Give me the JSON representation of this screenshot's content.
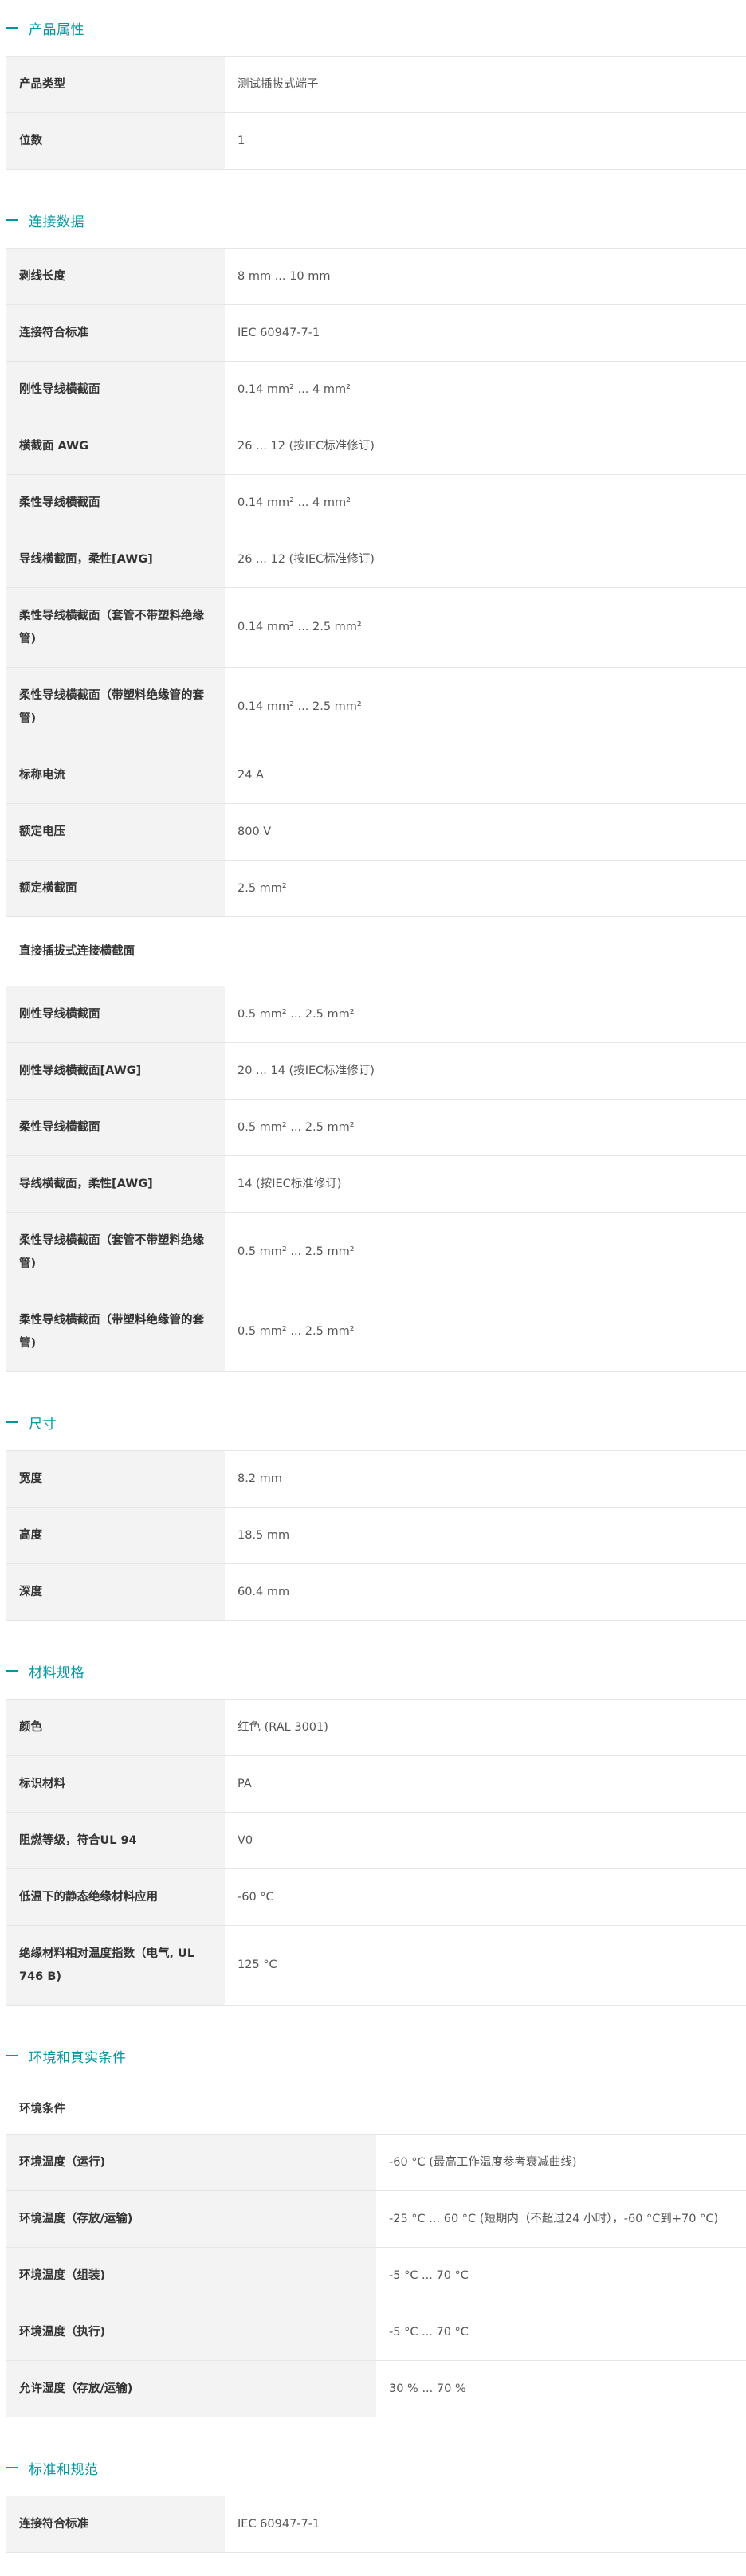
{
  "sections": {
    "product": {
      "title": "产品属性",
      "rows": [
        {
          "label": "产品类型",
          "value": "测试插拔式端子"
        },
        {
          "label": "位数",
          "value": "1"
        }
      ]
    },
    "connection": {
      "title": "连接数据",
      "rows": [
        {
          "label": "剥线长度",
          "value": "8 mm ... 10 mm"
        },
        {
          "label": "连接符合标准",
          "value": "IEC 60947-7-1"
        },
        {
          "label": "刚性导线横截面",
          "value": "0.14 mm² ... 4 mm²"
        },
        {
          "label": "横截面 AWG",
          "value": "26 ... 12 (按IEC标准修订)"
        },
        {
          "label": "柔性导线横截面",
          "value": "0.14 mm² ... 4 mm²"
        },
        {
          "label": "导线横截面，柔性[AWG]",
          "value": "26 ... 12 (按IEC标准修订)"
        },
        {
          "label": "柔性导线横截面（套管不带塑料绝缘管)",
          "value": "0.14 mm² ... 2.5 mm²"
        },
        {
          "label": "柔性导线横截面（带塑料绝缘管的套管)",
          "value": "0.14 mm² ... 2.5 mm²"
        },
        {
          "label": "标称电流",
          "value": "24 A"
        },
        {
          "label": "额定电压",
          "value": "800 V"
        },
        {
          "label": "额定横截面",
          "value": "2.5 mm²"
        }
      ],
      "sub_title": "直接插拔式连接横截面",
      "sub_rows": [
        {
          "label": "刚性导线横截面",
          "value": "0.5 mm² ... 2.5 mm²"
        },
        {
          "label": "刚性导线横截面[AWG]",
          "value": "20 ... 14 (按IEC标准修订)"
        },
        {
          "label": "柔性导线横截面",
          "value": "0.5 mm² ... 2.5 mm²"
        },
        {
          "label": "导线横截面，柔性[AWG]",
          "value": "14 (按IEC标准修订)"
        },
        {
          "label": "柔性导线横截面（套管不带塑料绝缘管)",
          "value": "0.5 mm² ... 2.5 mm²"
        },
        {
          "label": "柔性导线横截面（带塑料绝缘管的套管)",
          "value": "0.5 mm² ... 2.5 mm²"
        }
      ]
    },
    "dimensions": {
      "title": "尺寸",
      "rows": [
        {
          "label": "宽度",
          "value": "8.2 mm"
        },
        {
          "label": "高度",
          "value": "18.5 mm"
        },
        {
          "label": "深度",
          "value": "60.4 mm"
        }
      ]
    },
    "material": {
      "title": "材料规格",
      "rows": [
        {
          "label": "颜色",
          "value": "红色 (RAL 3001)"
        },
        {
          "label": "标识材料",
          "value": "PA"
        },
        {
          "label": "阻燃等级，符合UL 94",
          "value": "V0"
        },
        {
          "label": "低温下的静态绝缘材料应用",
          "value": "-60 °C"
        },
        {
          "label": "绝缘材料相对温度指数（电气, UL 746 B)",
          "value": "125 °C"
        }
      ]
    },
    "environment": {
      "title": "环境和真实条件",
      "sub_title": "环境条件",
      "rows": [
        {
          "label": "环境温度（运行)",
          "value": "-60 °C (最高工作温度参考衰减曲线)"
        },
        {
          "label": "环境温度（存放/运输)",
          "value": "-25 °C ... 60 °C (短期内（不超过24 小时），-60 °C到+70 °C)"
        },
        {
          "label": "环境温度（组装)",
          "value": "-5 °C ... 70 °C"
        },
        {
          "label": "环境温度（执行)",
          "value": "-5 °C ... 70 °C"
        },
        {
          "label": "允许湿度（存放/运输)",
          "value": "30 % ... 70 %"
        }
      ]
    },
    "standards": {
      "title": "标准和规范",
      "rows": [
        {
          "label": "连接符合标准",
          "value": "IEC 60947-7-1"
        }
      ]
    }
  },
  "colors": {
    "accent": "#0098a1",
    "label_bg": "#f3f3f3",
    "border": "#e6e6e6"
  },
  "icons": {
    "section_marker": "minus-icon"
  }
}
